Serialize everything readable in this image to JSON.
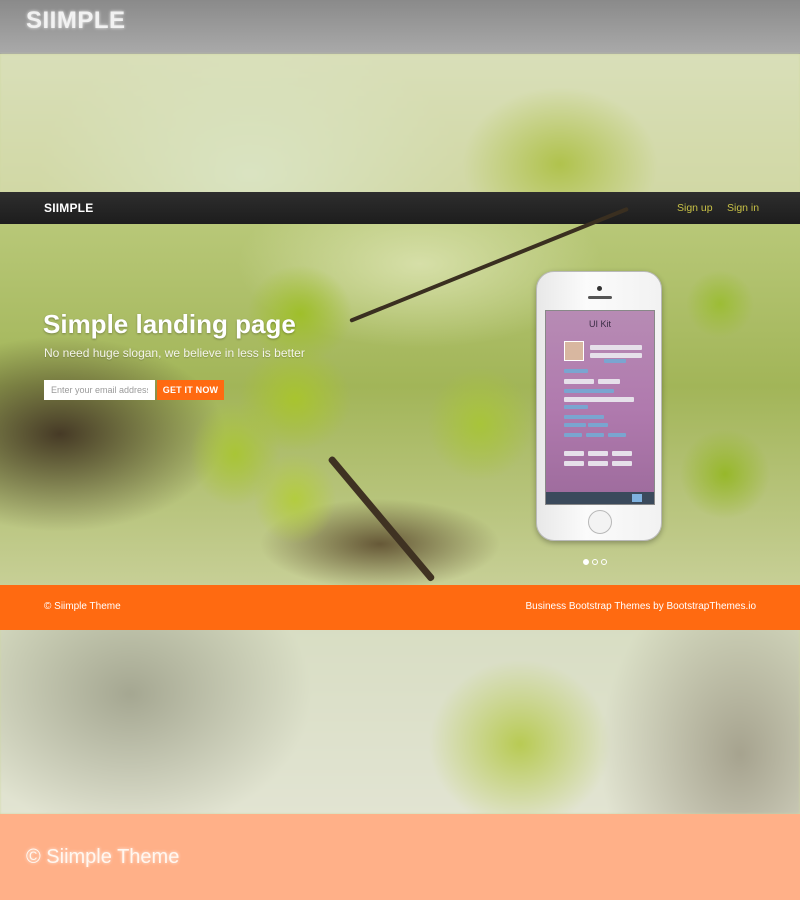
{
  "backdrop": {
    "logo": "SIIMPLE",
    "copyright": "© Siimple Theme"
  },
  "navbar": {
    "brand": "SIIMPLE",
    "links": [
      "Sign up",
      "Sign in"
    ]
  },
  "hero": {
    "title": "Simple landing page",
    "slogan": "No need huge slogan, we believe in less is better",
    "email_placeholder": "Enter your email address",
    "cta_label": "GET IT NOW"
  },
  "phone": {
    "screen_title": "UI Kit"
  },
  "carousel": {
    "dot_count": 3,
    "active_index": 0
  },
  "footer": {
    "copyright": "© Siimple Theme",
    "credit": "Business Bootstrap Themes by BootstrapThemes.io"
  },
  "colors": {
    "accent": "#ff6a11",
    "nav_link": "#c7c046",
    "navbar": "#1d1d1d"
  }
}
